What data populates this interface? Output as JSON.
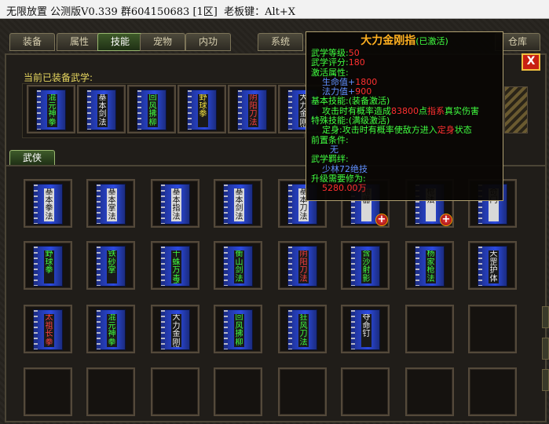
{
  "window": {
    "title": "无限放置 公测版V0.339 群604150683 [1区]  老板键：Alt+X"
  },
  "tabs": [
    "装备",
    "属性",
    "技能",
    "宠物",
    "内功",
    "系统",
    "仓库"
  ],
  "close_label": "X",
  "equipped": {
    "label": "当前已装备武学:",
    "books": [
      {
        "name": "混元神拳",
        "color": "green"
      },
      {
        "name": "基本剑法",
        "color": "white"
      },
      {
        "name": "回风拂柳",
        "color": "green"
      },
      {
        "name": "野球拳",
        "color": "yellow"
      },
      {
        "name": "阴阳刀法",
        "color": "red"
      },
      {
        "name": "大力金刚指",
        "color": "white"
      }
    ]
  },
  "section_tab": "武侠",
  "library": {
    "rows": [
      [
        {
          "name": "基本拳法",
          "color": "plain"
        },
        {
          "name": "基本掌法",
          "color": "plain"
        },
        {
          "name": "基本指法",
          "color": "plain"
        },
        {
          "name": "基本剑法",
          "color": "plain"
        },
        {
          "name": "基本刀法",
          "color": "plain"
        },
        {
          "name": "暗器",
          "color": "plain",
          "plus": true
        },
        {
          "name": "枪法",
          "color": "plain",
          "plus": true
        },
        {
          "name": "奇门",
          "color": "plain"
        }
      ],
      [
        {
          "name": "野球拳",
          "color": "green"
        },
        {
          "name": "铁砂掌",
          "color": "green"
        },
        {
          "name": "千蛛万毒手",
          "color": "green"
        },
        {
          "name": "衡山剑法",
          "color": "green"
        },
        {
          "name": "阴阳刀法",
          "color": "red"
        },
        {
          "name": "含沙射影",
          "color": "green"
        },
        {
          "name": "杨家枪法",
          "color": "green"
        },
        {
          "name": "天罡护体",
          "color": "white"
        }
      ],
      [
        {
          "name": "太祖长拳",
          "color": "red"
        },
        {
          "name": "混元神拳",
          "color": "green"
        },
        {
          "name": "大力金刚指",
          "color": "white"
        },
        {
          "name": "回风拂柳",
          "color": "green"
        },
        {
          "name": "狂风刀法",
          "color": "green"
        },
        {
          "name": "夺命钉",
          "color": "white"
        },
        null,
        null
      ],
      [
        null,
        null,
        null,
        null,
        null,
        null,
        null,
        null
      ]
    ]
  },
  "tooltip": {
    "name": "大力金刚指",
    "state": "(已激活)",
    "level_label": "武学等级:",
    "level_value": "50",
    "score_label": "武学评分:",
    "score_value": "180",
    "attr_label": "激活属性:",
    "hp_label": "生命值+",
    "hp_value": "1800",
    "mp_label": "法力值+",
    "mp_value": "900",
    "basic_label": "基本技能:(装备激活)",
    "basic_pre": "攻击时有概率造成",
    "basic_num": "83800",
    "basic_mid": "点",
    "basic_key": "指系",
    "basic_post": "真实伤害",
    "special_label": "特殊技能:(满级激活)",
    "special_name": "定身",
    "special_pre": ":攻击时有概率使敌方进入",
    "special_key": "定身",
    "special_post": "状态",
    "prereq_label": "前置条件:",
    "prereq_value": "无",
    "bond_label": "武学羁绊:",
    "bond_value": "少林72绝技",
    "upgrade_label": "升级需要修为:",
    "upgrade_value": "5280.00万"
  }
}
